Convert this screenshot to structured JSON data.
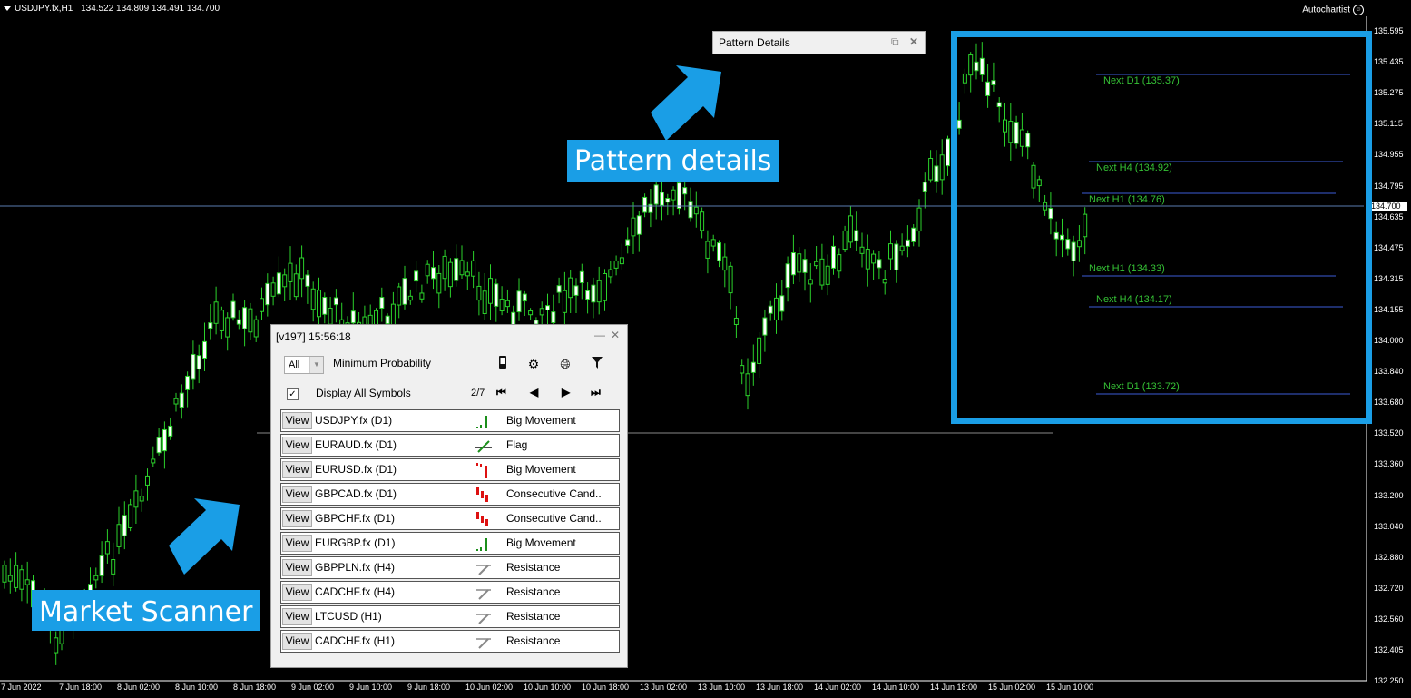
{
  "header": {
    "symbol": "USDJPY.fx,H1",
    "ohlc": "134.522 134.809 134.491 134.700",
    "brand": "Autochartist"
  },
  "y_axis": {
    "ticks": [
      "135.595",
      "135.435",
      "135.275",
      "135.115",
      "134.955",
      "134.795",
      "134.635",
      "134.475",
      "134.315",
      "134.155",
      "134.000",
      "133.840",
      "133.680",
      "133.520",
      "133.360",
      "133.200",
      "133.040",
      "132.880",
      "132.720",
      "132.560",
      "132.405",
      "132.250"
    ],
    "current_price": "134.700"
  },
  "x_axis": {
    "ticks": [
      "7 Jun 2022",
      "7 Jun 18:00",
      "8 Jun 02:00",
      "8 Jun 10:00",
      "8 Jun 18:00",
      "9 Jun 02:00",
      "9 Jun 10:00",
      "9 Jun 18:00",
      "10 Jun 02:00",
      "10 Jun 10:00",
      "10 Jun 18:00",
      "13 Jun 02:00",
      "13 Jun 10:00",
      "13 Jun 18:00",
      "14 Jun 02:00",
      "14 Jun 10:00",
      "14 Jun 18:00",
      "15 Jun 02:00",
      "15 Jun 10:00"
    ]
  },
  "levels": [
    {
      "label": "Next D1 (135.37)"
    },
    {
      "label": "Next H4 (134.92)"
    },
    {
      "label": "Next H1 (134.76)"
    },
    {
      "label": "Next H1 (134.33)"
    },
    {
      "label": "Next H4 (134.17)"
    },
    {
      "label": "Next D1 (133.72)"
    }
  ],
  "callouts": {
    "pattern_details": "Pattern details",
    "market_scanner": "Market Scanner"
  },
  "pattern_details_window": {
    "title": "Pattern Details"
  },
  "scanner": {
    "title": "[v197] 15:56:18",
    "filter_value": "All",
    "min_probability_label": "Minimum Probability",
    "display_all_label": "Display All Symbols",
    "display_all_checked": true,
    "page": "2/7",
    "view_label": "View",
    "rows": [
      {
        "symbol": "USDJPY.fx (D1)",
        "pattern": "Big Movement",
        "icon": "big-movement-up-icon"
      },
      {
        "symbol": "EURAUD.fx (D1)",
        "pattern": "Flag",
        "icon": "flag-icon"
      },
      {
        "symbol": "EURUSD.fx (D1)",
        "pattern": "Big Movement",
        "icon": "big-movement-down-icon"
      },
      {
        "symbol": "GBPCAD.fx (D1)",
        "pattern": "Consecutive Cand..",
        "icon": "consecutive-candles-down-icon"
      },
      {
        "symbol": "GBPCHF.fx (D1)",
        "pattern": "Consecutive Cand..",
        "icon": "consecutive-candles-down-icon"
      },
      {
        "symbol": "EURGBP.fx (D1)",
        "pattern": "Big Movement",
        "icon": "big-movement-up-icon"
      },
      {
        "symbol": "GBPPLN.fx (H4)",
        "pattern": "Resistance",
        "icon": "resistance-icon"
      },
      {
        "symbol": "CADCHF.fx (H4)",
        "pattern": "Resistance",
        "icon": "resistance-icon"
      },
      {
        "symbol": "LTCUSD (H1)",
        "pattern": "Resistance",
        "icon": "resistance-icon"
      },
      {
        "symbol": "CADCHF.fx (H1)",
        "pattern": "Resistance",
        "icon": "resistance-icon"
      }
    ]
  },
  "colors": {
    "accent": "#1a9ee6",
    "candle": "#2bd12b",
    "level_line": "#3b5bd6",
    "level_text": "#35c135"
  }
}
